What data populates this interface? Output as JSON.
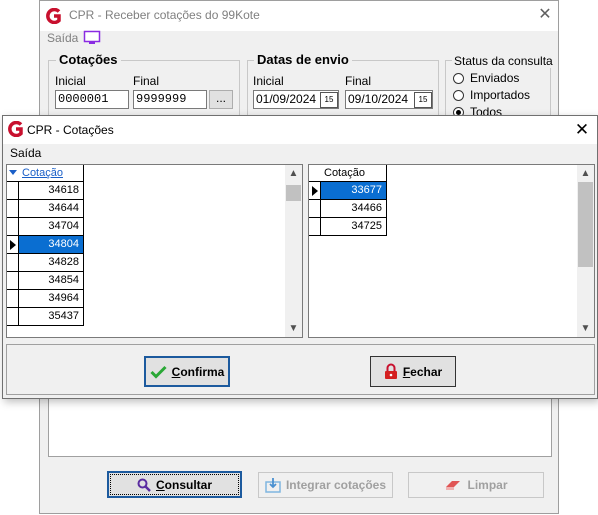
{
  "bg_window": {
    "title": "CPR - Receber cotações do 99Kote",
    "menu_saida": "Saída",
    "cotacoes": {
      "label": "Cotações",
      "inicial_label": "Inicial",
      "inicial_value": "0000001",
      "final_label": "Final",
      "final_value": "9999999",
      "browse_label": "..."
    },
    "datas": {
      "label": "Datas de envio",
      "inicial_label": "Inicial",
      "inicial_value": "01/09/2024",
      "final_label": "Final",
      "final_value": "09/10/2024",
      "calendar_glyph": "15"
    },
    "status": {
      "label": "Status da consulta",
      "options": [
        "Enviados",
        "Importados",
        "Todos"
      ],
      "selected": "Todos"
    },
    "buttons": {
      "consultar_first": "C",
      "consultar_rest": "onsultar",
      "integrar": "Integrar cotações",
      "limpar": "Limpar"
    }
  },
  "dialog": {
    "title": "CPR - Cotações",
    "menu_saida": "Saída",
    "left_grid": {
      "header": "Cotação",
      "rows": [
        "34618",
        "34644",
        "34704",
        "34804",
        "34828",
        "34854",
        "34964",
        "35437"
      ],
      "selected_row": "34804"
    },
    "right_grid": {
      "header": "Cotação",
      "rows": [
        "33677",
        "34466",
        "34725"
      ],
      "selected_row": "33677"
    },
    "buttons": {
      "confirma_first": "C",
      "confirma_rest": "onfirma",
      "fechar_first": "F",
      "fechar_rest": "echar"
    }
  },
  "colors": {
    "selection": "#0a6ed1",
    "title_inactive": "#808080",
    "brand_logo": "#c8102e"
  }
}
